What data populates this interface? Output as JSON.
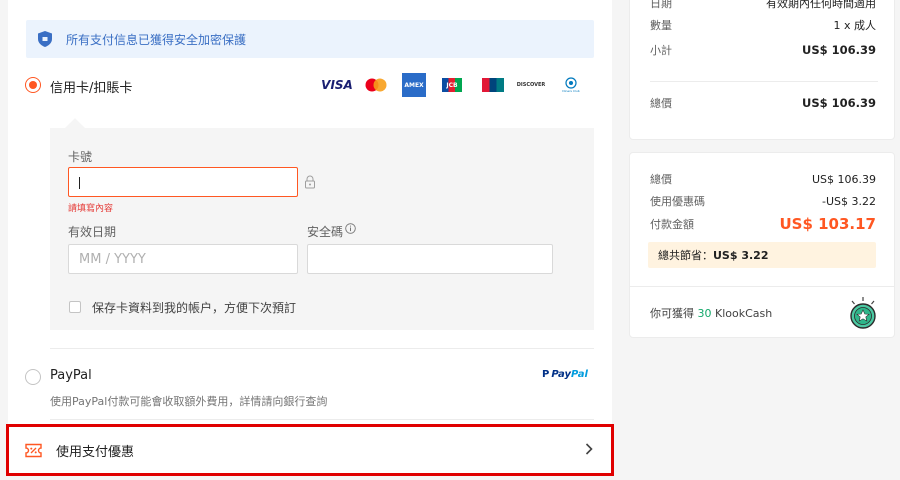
{
  "security": {
    "text": "所有支付信息已獲得安全加密保護",
    "icon": "shield-icon"
  },
  "card_option": {
    "label": "信用卡/扣賬卡",
    "selected": true,
    "brands": [
      "VISA",
      "mastercard",
      "AMEX",
      "JCB",
      "UnionPay",
      "DISCOVER",
      "Diners Club"
    ]
  },
  "card_form": {
    "card_number_label": "卡號",
    "card_number_value": "",
    "card_number_error": "請填寫內容",
    "expiry_label": "有效日期",
    "expiry_placeholder": "MM / YYYY",
    "cvv_label": "安全碼",
    "cvv_value": "",
    "save_card_label": "保存卡資料到我的帳户，方便下次預訂",
    "save_card_checked": false
  },
  "paypal_option": {
    "label": "PayPal",
    "note": "使用PayPal付款可能會收取額外費用，詳情請向銀行查詢",
    "logo_pay": "Pay",
    "logo_pal": "Pal",
    "selected": false
  },
  "promo": {
    "label": "使用支付優惠"
  },
  "summary_top": {
    "date_label": "日期",
    "date_value": "有效期內任何時間適用",
    "qty_label": "數量",
    "qty_value": "1 x 成人",
    "subtotal_label": "小計",
    "subtotal_value": "US$ 106.39",
    "total_label": "總價",
    "total_value": "US$ 106.39"
  },
  "summary_pay": {
    "total_label": "總價",
    "total_value": "US$ 106.39",
    "discount_label": "使用優惠碼",
    "discount_value": "-US$ 3.22",
    "pay_label": "付款金額",
    "pay_value": "US$ 103.17",
    "saved_label": "總共節省：",
    "saved_value": "US$ 3.22",
    "earn_prefix": "你可獲得",
    "earn_amount": "30",
    "earn_suffix": "KlookCash"
  },
  "colors": {
    "accent": "#ff5722",
    "link_blue": "#3a6fc4",
    "highlight_red": "#e00000",
    "green": "#13a86b"
  }
}
